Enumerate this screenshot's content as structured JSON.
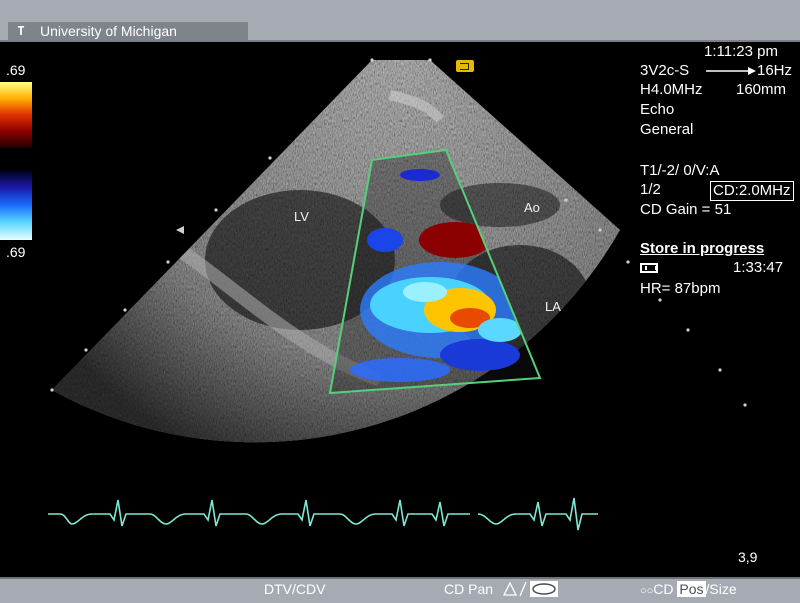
{
  "header": {
    "institution": "University of Michigan",
    "icon": "T"
  },
  "scale": {
    "top": ".69",
    "bottom": ".69"
  },
  "labels": {
    "lv": "LV",
    "ao": "Ao",
    "la": "LA"
  },
  "info": {
    "time": "1:11:23 pm",
    "probe": "3V2c-S",
    "frame_rate": "16Hz",
    "freq": "H4.0MHz",
    "depth": "160mm",
    "mode1": "Echo",
    "mode2": "General",
    "preset": "T1/-2/ 0/V:A",
    "ratio": "1/2",
    "cd_freq": "CD:2.0MHz",
    "cd_gain": "CD Gain = 51",
    "store": "Store in progress",
    "store_time": "1:33:47",
    "hr": "HR= 87bpm"
  },
  "corner": "3,9",
  "bottom": {
    "dtv_cdv": "DTV/CDV",
    "cd_pan": "CD Pan",
    "cd": "CD",
    "pos": "Pos",
    "size": "/Size"
  },
  "colors": {
    "roi_box": "#55d07a",
    "ecg": "#7fe8d4",
    "toolbar": "#a6abb3"
  }
}
